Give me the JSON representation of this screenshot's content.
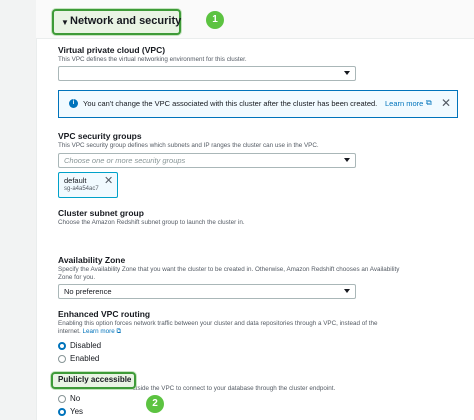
{
  "network_section": {
    "title": "Network and security",
    "callout_1": "1",
    "callout_2": "2"
  },
  "vpc": {
    "label": "Virtual private cloud (VPC)",
    "description": "This VPC defines the virtual networking environment for this cluster.",
    "value": ""
  },
  "vpc_info": {
    "message": "You can't change the VPC associated with this cluster after the cluster has been created.",
    "link": "Learn more",
    "icon": "info-icon"
  },
  "security_groups": {
    "label": "VPC security groups",
    "description": "This VPC security group defines which subnets and IP ranges the cluster can use in the VPC.",
    "placeholder": "Choose one or more security groups",
    "token_name": "default",
    "token_id": "sg-a4a54ac7"
  },
  "subnet_group": {
    "label": "Cluster subnet group",
    "description": "Choose the Amazon Redshift subnet group to launch the cluster in."
  },
  "availability_zone": {
    "label": "Availability Zone",
    "description_line1": "Specify the Availability Zone that you want the cluster to be created in. Otherwise, Amazon Redshift chooses an Availability",
    "description_line2": "Zone for you.",
    "value": "No preference"
  },
  "enhanced_routing": {
    "label": "Enhanced VPC routing",
    "description_line1": "Enabling this option forces network traffic between your cluster and data repositories through a VPC, instead of the",
    "description_line2": "internet.",
    "link": "Learn more",
    "options": [
      "Disabled",
      "Enabled"
    ],
    "selected": "Disabled"
  },
  "public_access": {
    "label": "Publicly accessible",
    "description": "... instances and devices outside the VPC to connect to your database through the cluster endpoint.",
    "options": [
      "No",
      "Yes"
    ],
    "selected": "Yes"
  },
  "colors": {
    "highlight_green": "#3e9b38",
    "callout_green": "#5cc341",
    "link_blue": "#0073bb"
  }
}
